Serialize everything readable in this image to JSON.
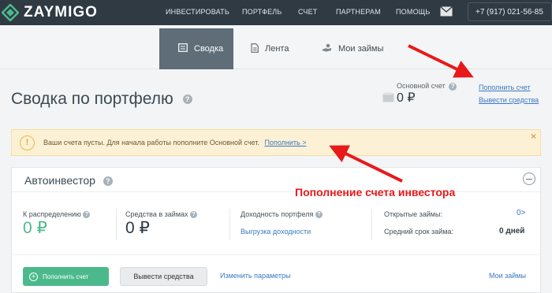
{
  "app": {
    "logo_text": "ZAYMIGO",
    "nav": [
      {
        "label": "Инвестировать"
      },
      {
        "label": "Портфель"
      },
      {
        "label": "Счет"
      },
      {
        "label": "Партнерам"
      },
      {
        "label": "Помощь"
      }
    ],
    "phone": "+7 (917) 021-56-85",
    "mail_icon": "envelope-icon"
  },
  "subnav": {
    "tabs": [
      {
        "label": "Сводка",
        "icon": "summary-icon",
        "active": true
      },
      {
        "label": "Лента",
        "icon": "document-icon",
        "active": false
      },
      {
        "label": "Мои займы",
        "icon": "hand-coins-icon",
        "active": false
      }
    ]
  },
  "header": {
    "title": "Сводка по портфелю",
    "account_label": "Основной счет",
    "account_value": "0 ₽",
    "topup_link": "Пополнить счет",
    "withdraw_link": "Вывести средства"
  },
  "warning": {
    "text": "Ваши счета пусты. Для начала работы пополните Основной счет.",
    "link": "Пополнить >",
    "close": "×"
  },
  "autoinvestor": {
    "title": "Автоинвестор",
    "to_distribute_label": "К распределению",
    "to_distribute_value": "0 ₽",
    "in_loans_label": "Средства в займах",
    "in_loans_value": "0 ₽",
    "yield_label": "Доходность портфеля",
    "yield_link": "Выгрузка доходности",
    "open_loans_label": "Открытые займы:",
    "open_loans_value": "0",
    "avg_term_label": "Средний срок займа:",
    "avg_term_value": "0 дней",
    "btn_topup": "Пополнить счет",
    "btn_withdraw": "Вывести средства",
    "link_params": "Изменить параметры",
    "link_my_loans": "Мои займы"
  },
  "annotation": {
    "text": "Пополнение счета инвестора",
    "color": "#e8191a"
  },
  "colors": {
    "topbar": "#2f3a43",
    "accent_green": "#4cb98d",
    "link_blue": "#3b78c2",
    "warning_bg": "#fcf1d4"
  }
}
